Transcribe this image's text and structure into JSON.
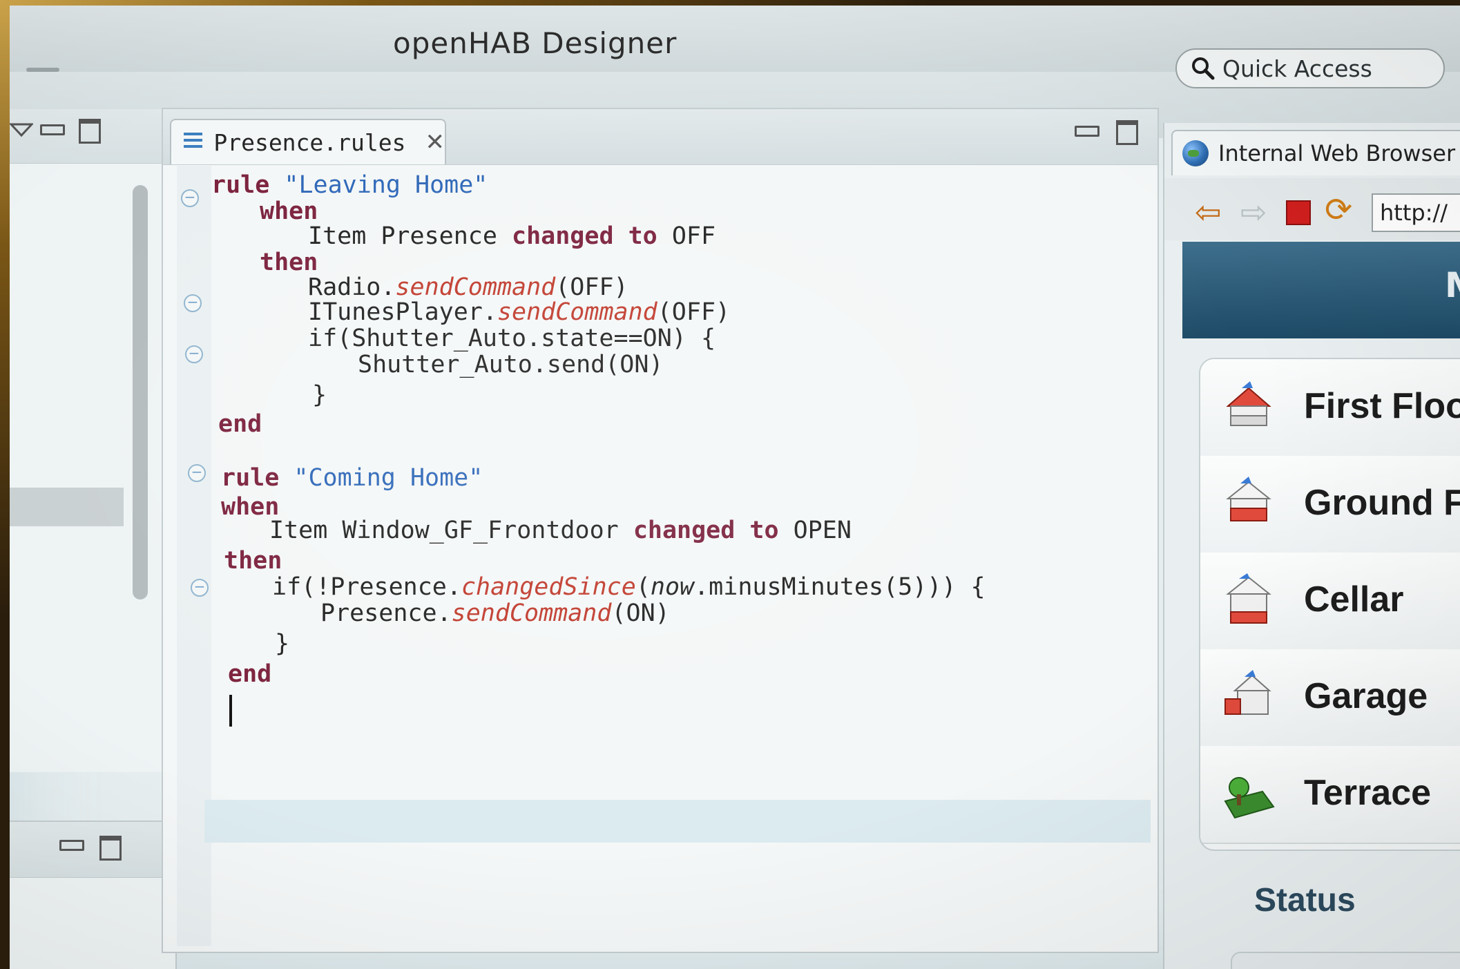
{
  "window": {
    "title": "openHAB Designer"
  },
  "toolbar": {
    "quick_access": "Quick Access"
  },
  "editor": {
    "tab_label": "Presence.rules",
    "lines": [
      [
        "rule",
        "\"Leaving Home\""
      ],
      [
        "when"
      ],
      [
        "Item Presence",
        "changed to",
        "OFF"
      ],
      [
        "then"
      ],
      [
        "Radio.",
        "sendCommand",
        "(OFF)"
      ],
      [
        "ITunesPlayer.",
        "sendCommand",
        "(OFF)"
      ],
      [
        "if(Shutter_Auto.state==ON) {"
      ],
      [
        "Shutter_Auto.send(ON)"
      ],
      [
        "}"
      ],
      [
        "end"
      ],
      [
        "rule",
        "\"Coming Home\""
      ],
      [
        "when"
      ],
      [
        "Item Window_GF_Frontdoor",
        "changed to",
        "OPEN"
      ],
      [
        "then"
      ],
      [
        "if(!Presence.",
        "changedSince",
        "(",
        "now",
        ".minusMinutes(5))) {"
      ],
      [
        "Presence.",
        "sendCommand",
        "(ON)"
      ],
      [
        "}"
      ],
      [
        "end"
      ]
    ]
  },
  "browser": {
    "tab_label": "Internal Web Browser",
    "url": "http://",
    "header_text": "M",
    "menu_items": [
      "First Floo",
      "Ground F",
      "Cellar",
      "Garage",
      "Terrace"
    ],
    "status_heading": "Status"
  }
}
